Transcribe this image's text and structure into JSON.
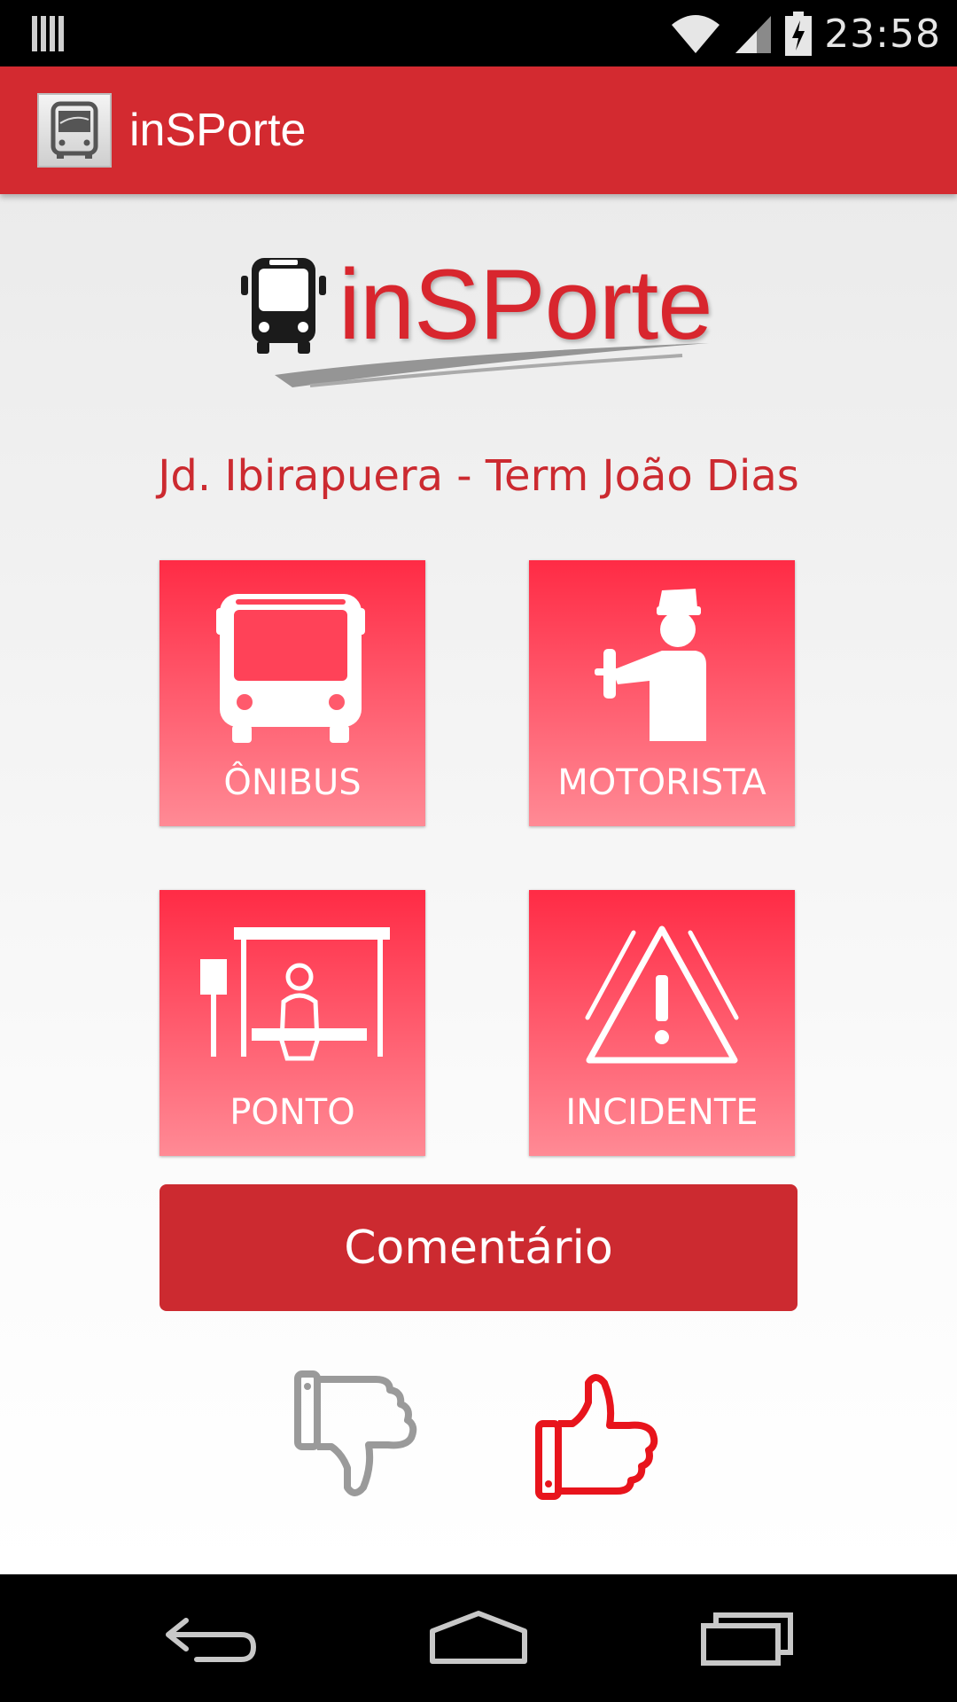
{
  "status_bar": {
    "time": "23:58",
    "icons": [
      "notification-bars-icon",
      "wifi-icon",
      "signal-icon",
      "battery-charging-icon"
    ]
  },
  "action_bar": {
    "app_icon": "bus-app-icon",
    "title": "inSPorte"
  },
  "logo": {
    "text": "inSPorte",
    "icon": "bus-front-icon"
  },
  "route_name": "Jd. Ibirapuera - Term João Dias",
  "tiles": [
    {
      "label": "ÔNIBUS",
      "icon": "bus-icon"
    },
    {
      "label": "MOTORISTA",
      "icon": "driver-icon"
    },
    {
      "label": "PONTO",
      "icon": "bus-stop-icon"
    },
    {
      "label": "INCIDENTE",
      "icon": "warning-icon"
    }
  ],
  "comment_button": "Comentário",
  "rating": {
    "dislike_icon": "thumbs-down-icon",
    "like_icon": "thumbs-up-icon",
    "like_color": "#e8141c",
    "dislike_color": "#9a9a9a"
  },
  "nav_bar": {
    "icons": [
      "back-icon",
      "home-icon",
      "recent-apps-icon"
    ]
  },
  "colors": {
    "accent": "#d32a30",
    "tile_top": "#ff2b45",
    "tile_bottom": "#ff8a95"
  }
}
